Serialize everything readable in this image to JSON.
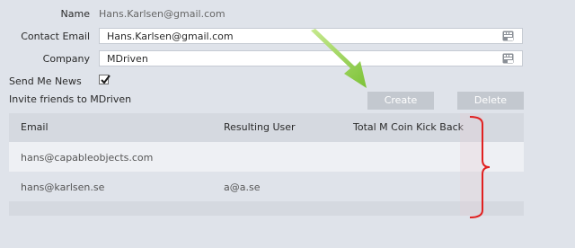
{
  "form": {
    "name_label": "Name",
    "name_value": "Hans.Karlsen@gmail.com",
    "contact_email_label": "Contact Email",
    "contact_email_value": "Hans.Karlsen@gmail.com",
    "company_label": "Company",
    "company_value": "MDriven",
    "send_news_label": "Send Me News",
    "send_news_checked": true
  },
  "invite": {
    "heading": "Invite friends to MDriven",
    "create_label": "Create",
    "delete_label": "Delete"
  },
  "table": {
    "columns": [
      "Email",
      "Resulting User",
      "Total M Coin Kick Back"
    ],
    "rows": [
      {
        "email": "hans@capableobjects.com",
        "user": "",
        "kickback": ""
      },
      {
        "email": "hans@karlsen.se",
        "user": "a@a.se",
        "kickback": ""
      }
    ]
  },
  "annotations": {
    "arrow_color": "#86c93a",
    "bracket_color": "#e02020"
  }
}
